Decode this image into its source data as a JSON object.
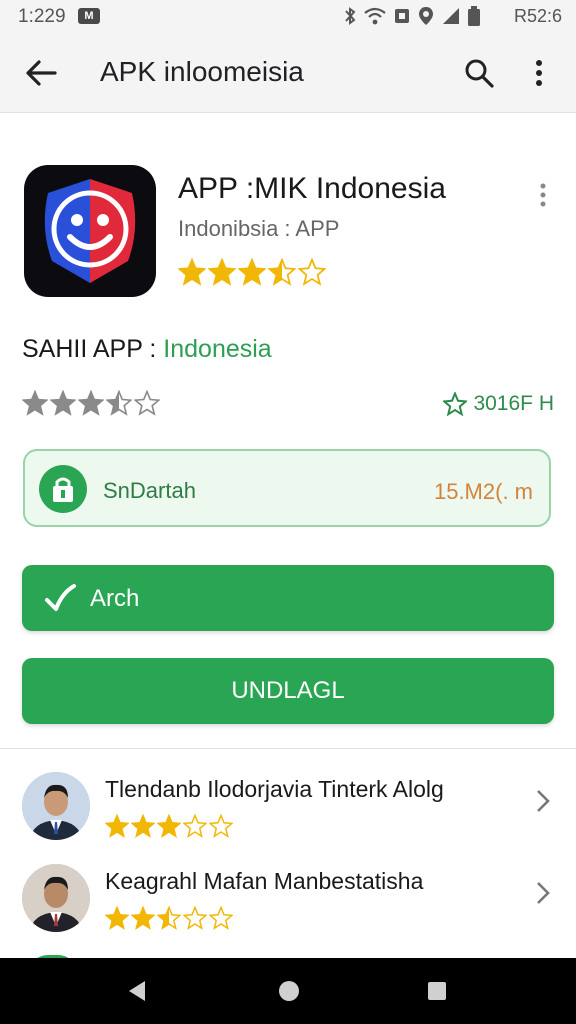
{
  "status_bar": {
    "time": "1:229",
    "battery_text": "R52:6"
  },
  "app_bar": {
    "title": "APK inloomeisia"
  },
  "app": {
    "name": "APP :MIK Indonesia",
    "subtitle": "Indonibsia :  APP",
    "rating": 3.5
  },
  "section": {
    "title_prefix": "SAHII APP : ",
    "title_highlight": "Indonesia",
    "rating": 3.5,
    "rating_count": "3016F H"
  },
  "safe_banner": {
    "label": "SnDartah",
    "size": "15.M2(. m"
  },
  "buttons": {
    "arch_label": "Arch",
    "install_label": "UNDLAGL"
  },
  "list": [
    {
      "title": "Tlendanb Ilodorjavia Tinterk Alolg",
      "rating": 3
    },
    {
      "title": "Keagrahl Mafan Manbestatisha",
      "rating": 2.5
    }
  ],
  "colors": {
    "accent": "#2aa553",
    "star": "#f2b705",
    "size_text": "#d4843a"
  }
}
